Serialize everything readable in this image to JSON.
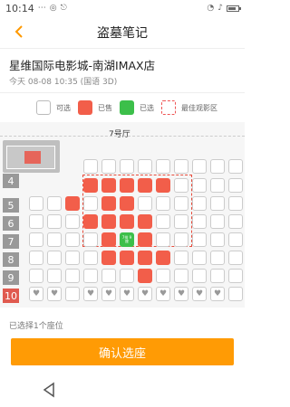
{
  "status": {
    "time": "10:14",
    "icons_left": [
      "signal-dots-icon",
      "ok-icon",
      "usb-icon"
    ],
    "icons_right": [
      "wifi-icon",
      "sound-icon",
      "battery-icon"
    ]
  },
  "header": {
    "back_icon": "chevron-left-icon",
    "title": "盗墓笔记"
  },
  "cinema": {
    "name": "星维国际电影城-南湖IMAX店",
    "session": "今天 08-08 10:35   (国语 3D)"
  },
  "legend": {
    "available": "可选",
    "sold": "已售",
    "selected": "已选",
    "best": "最佳观影区"
  },
  "hall": {
    "name": "7号厅"
  },
  "rows": [
    "4",
    "5",
    "6",
    "7",
    "8",
    "9",
    "10"
  ],
  "selected_seat_label": "7排\n9座",
  "selected_info": "已选择1个座位",
  "confirm_label": "确认选座",
  "colors": {
    "accent": "#ff9b05",
    "sold": "#f25e4a",
    "selected": "#3cbf4a",
    "best_zone": "#e74c3c"
  }
}
